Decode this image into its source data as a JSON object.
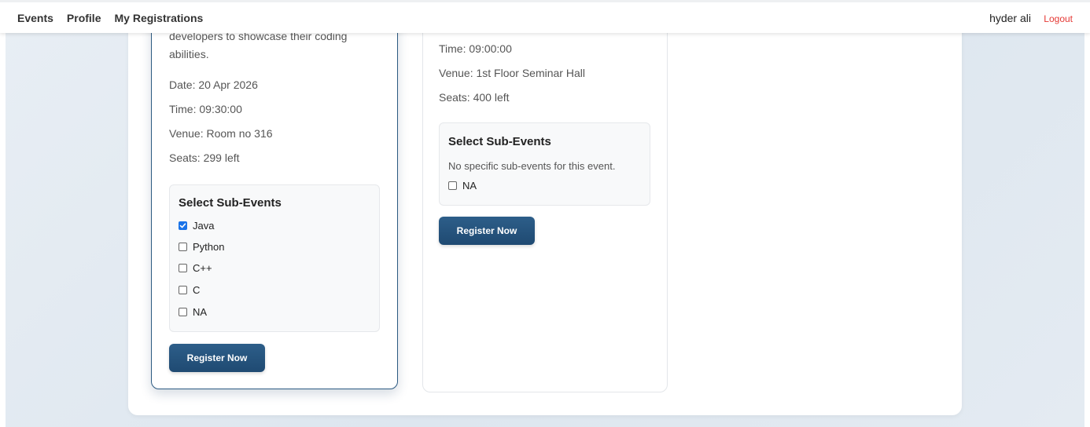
{
  "nav": {
    "links": [
      "Events",
      "Profile",
      "My Registrations"
    ],
    "user_name": "hyder ali",
    "logout_label": "Logout"
  },
  "events": [
    {
      "description": "developers to showcase their coding abilities.",
      "date": "Date: 20 Apr 2026",
      "time": "Time: 09:30:00",
      "venue": "Venue: Room no 316",
      "seats": "Seats: 299 left",
      "subevents_title": "Select Sub-Events",
      "options": [
        {
          "label": "Java",
          "checked": true
        },
        {
          "label": "Python",
          "checked": false
        },
        {
          "label": "C++",
          "checked": false
        },
        {
          "label": "C",
          "checked": false
        },
        {
          "label": "NA",
          "checked": false
        }
      ],
      "register_label": "Register Now"
    },
    {
      "time": "Time: 09:00:00",
      "venue": "Venue: 1st Floor Seminar Hall",
      "seats": "Seats: 400 left",
      "subevents_title": "Select Sub-Events",
      "no_subevents_note": "No specific sub-events for this event.",
      "options": [
        {
          "label": "NA",
          "checked": false
        }
      ],
      "register_label": "Register Now"
    }
  ]
}
